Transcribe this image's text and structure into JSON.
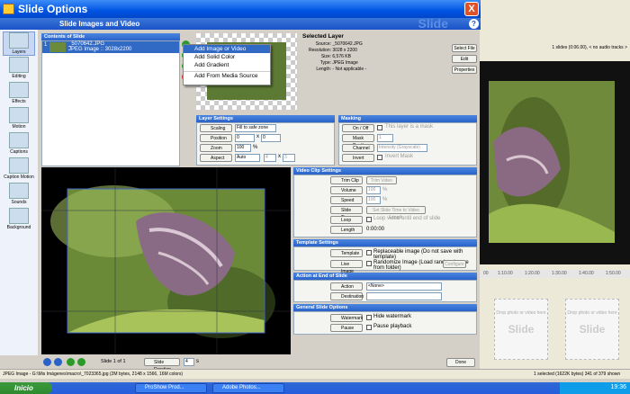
{
  "window": {
    "title": "Slide Options",
    "header": "Slide Images and Video",
    "watermark": "Slide",
    "close": "X",
    "help": "?"
  },
  "sidebar": [
    {
      "label": "Layers",
      "icon": "layers-icon",
      "active": true
    },
    {
      "label": "Editing",
      "icon": "editing-icon"
    },
    {
      "label": "Effects",
      "icon": "effects-icon"
    },
    {
      "label": "Motion",
      "icon": "motion-icon"
    },
    {
      "label": "Captions",
      "icon": "captions-icon"
    },
    {
      "label": "Caption Motion",
      "icon": "caption-motion-icon"
    },
    {
      "label": "Sounds",
      "icon": "sounds-icon"
    },
    {
      "label": "Background",
      "icon": "background-icon"
    }
  ],
  "contents": {
    "title": "Contents of Slide",
    "item_index": "1",
    "item_name": "_5070642.JPG",
    "item_desc": "JPEG Image :: 3028x2200"
  },
  "context_menu": [
    "Add Image or Video",
    "Add Solid Color",
    "Add Gradient",
    "Add From Media Source"
  ],
  "selected_layer": {
    "title": "Selected Layer",
    "fields": [
      {
        "label": "Source:",
        "value": "_5070642.JPG"
      },
      {
        "label": "Resolution:",
        "value": "3028 x 2200"
      },
      {
        "label": "Size:",
        "value": "6,576 KB"
      },
      {
        "label": "Type:",
        "value": "JPEG Image"
      },
      {
        "label": "Length:",
        "value": "- Not applicable -"
      }
    ],
    "buttons": [
      "Select File",
      "Edit",
      "Properties"
    ]
  },
  "layer_settings": {
    "title": "Layer Settings",
    "scaling_label": "Scaling",
    "scaling_value": "Fill to safe zone",
    "position_label": "Position",
    "position_x": "0",
    "position_y": "0",
    "zoom_label": "Zoom",
    "zoom_value": "100",
    "zoom_unit": "%",
    "aspect_label": "Aspect",
    "aspect_value": "Auto",
    "aspect_x": "4",
    "aspect_y": "3",
    "sep": "x"
  },
  "masking": {
    "title": "Masking",
    "onoff_label": "On / Off",
    "onoff_text": "This layer is a mask",
    "mask_depth_label": "Mask Depth",
    "mask_depth_value": "1",
    "channel_label": "Channel",
    "channel_value": "Intensity (Grayscale)",
    "invert_label": "Invert",
    "invert_text": "Invert Mask"
  },
  "video_clip": {
    "title": "Video Clip Settings",
    "trim_label": "Trim Clip",
    "trim_btn": "Trim Video",
    "volume_label": "Volume",
    "volume_value": "100",
    "pct": "%",
    "speed_label": "Speed",
    "speed_value": "100",
    "slide_time_label": "Slide Time",
    "slide_time_btn": "Set Slide Time to Video Length",
    "loop_label": "Loop",
    "loop_text": "Loop video until end of slide",
    "length_label": "Length",
    "length_value": "0:00:00"
  },
  "template": {
    "title": "Template Settings",
    "template_label": "Template",
    "template_text": "Replaceable image (Do not save with template)",
    "live_label": "Live Image",
    "live_text": "Randomize Image (Load random image from folder)",
    "configure": "Configure"
  },
  "action_end": {
    "title": "Action at End of Slide",
    "action_label": "Action",
    "action_value": "<None>",
    "destination_label": "Destination"
  },
  "general": {
    "title": "General Slide Options",
    "watermark_label": "Watermark",
    "watermark_text": "Hide watermark",
    "pause_label": "Pause",
    "pause_text": "Pause playback"
  },
  "bottom": {
    "slide_of": "Slide 1 of 1",
    "duration_label": "Slide Duration",
    "duration_value": "4",
    "duration_unit": "s",
    "done": "Done"
  },
  "status": {
    "left": "JPEG Image - G:\\Mis Imágenes\\macro\\_7023365.jpg  (2M bytes, 2148 x 1566, 16M colors)",
    "right": "1 selected (1622K bytes) 341 of 379 shown"
  },
  "right_app": {
    "slides_info": "1 slides (0:06.00), < no audio tracks >",
    "ruler": [
      "00",
      "1:10.00",
      "1:20.00",
      "1:30.00",
      "1:40.00",
      "1:50.00"
    ],
    "drop": "Drop photo or video here",
    "slide_word": "Slide"
  },
  "taskbar": {
    "start": "Inicio",
    "items": [
      "ProShow Prod...",
      "Adobe Photos..."
    ],
    "time": "19:36"
  },
  "colors": {
    "title_blue": "#0054e3",
    "panel_blue": "#2a62c8",
    "start_green": "#2f8a2f"
  }
}
